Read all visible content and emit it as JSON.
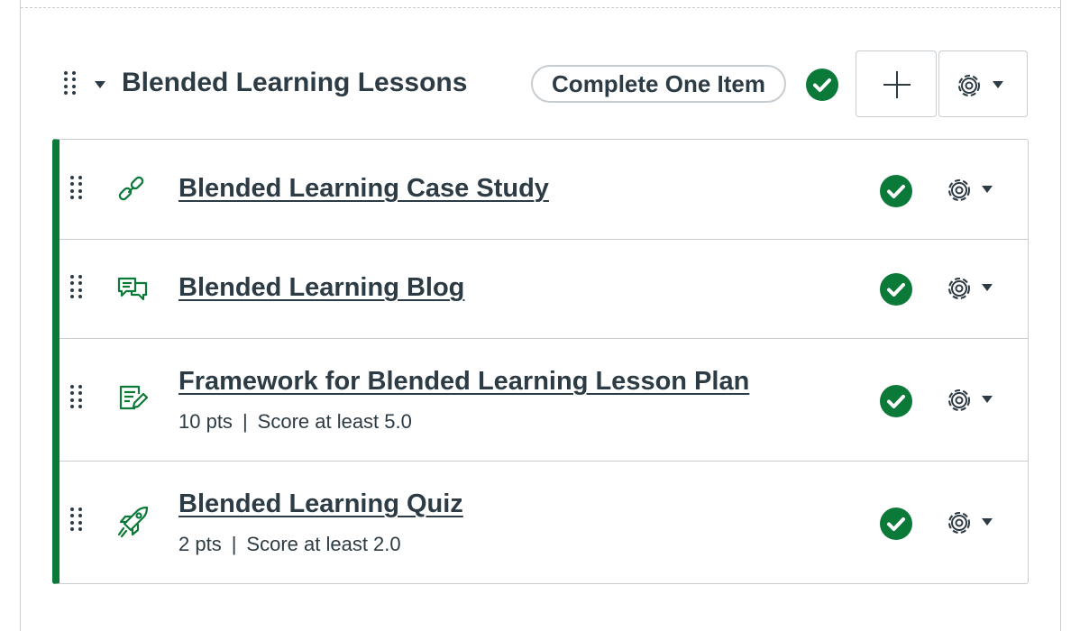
{
  "module": {
    "title": "Blended Learning Lessons",
    "requirement": "Complete One Item",
    "accent_color": "#0b7a38",
    "icons": [
      "drag-handle-icon",
      "caret-down-icon",
      "checkmark-icon",
      "plus-icon",
      "gear-icon"
    ]
  },
  "items": [
    {
      "title": "Blended Learning Case Study",
      "type_icon": "link-icon",
      "completed": true
    },
    {
      "title": "Blended Learning Blog",
      "type_icon": "discussion-icon",
      "completed": true
    },
    {
      "title": "Framework for Blended Learning Lesson Plan",
      "type_icon": "assignment-icon",
      "points": "10 pts",
      "separator": "|",
      "requirement": "Score at least 5.0",
      "completed": true
    },
    {
      "title": "Blended Learning Quiz",
      "type_icon": "quiz-icon",
      "points": "2 pts",
      "separator": "|",
      "requirement": "Score at least 2.0",
      "completed": true
    }
  ]
}
